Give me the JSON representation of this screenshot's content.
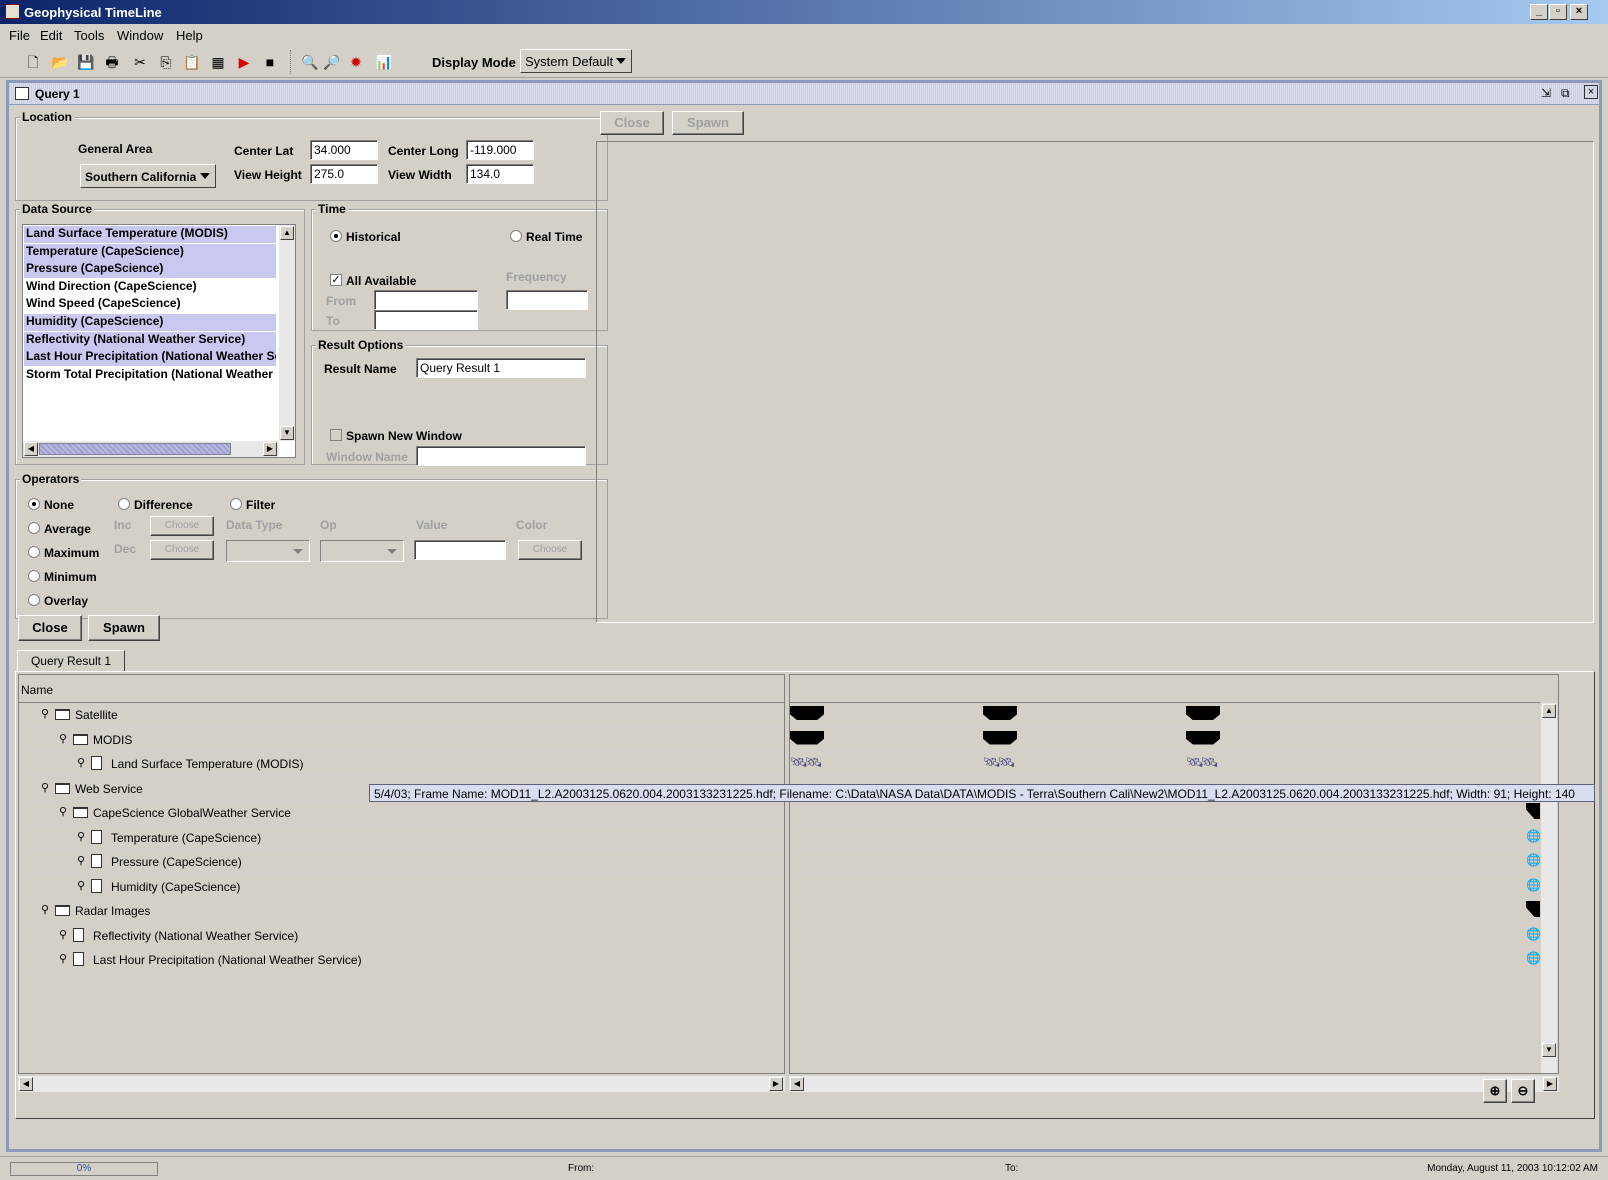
{
  "window": {
    "title": "Geophysical TimeLine"
  },
  "menu": [
    "File",
    "Edit",
    "Tools",
    "Window",
    "Help"
  ],
  "toolbar": {
    "display_mode_label": "Display Mode",
    "display_mode_value": "System Default"
  },
  "frame": {
    "title": "Query 1"
  },
  "location": {
    "title": "Location",
    "general_area_label": "General Area",
    "general_area_value": "Southern California",
    "center_lat_label": "Center Lat",
    "center_lat_value": "34.000",
    "center_long_label": "Center Long",
    "center_long_value": "-119.000",
    "view_height_label": "View Height",
    "view_height_value": "275.0",
    "view_width_label": "View Width",
    "view_width_value": "134.0"
  },
  "data_source": {
    "title": "Data Source",
    "items": [
      {
        "label": "Land Surface Temperature (MODIS)",
        "selected": true
      },
      {
        "label": "Temperature (CapeScience)",
        "selected": true
      },
      {
        "label": "Pressure (CapeScience)",
        "selected": true
      },
      {
        "label": "Wind Direction (CapeScience)",
        "selected": false
      },
      {
        "label": "Wind Speed (CapeScience)",
        "selected": false
      },
      {
        "label": "Humidity (CapeScience)",
        "selected": true
      },
      {
        "label": "Reflectivity (National Weather Service)",
        "selected": true
      },
      {
        "label": "Last Hour Precipitation (National Weather Ser",
        "selected": true
      },
      {
        "label": "Storm Total Precipitation (National Weather S",
        "selected": false
      }
    ]
  },
  "time": {
    "title": "Time",
    "historical_label": "Historical",
    "realtime_label": "Real Time",
    "all_available_label": "All Available",
    "frequency_label": "Frequency",
    "from_label": "From",
    "to_label": "To"
  },
  "result_options": {
    "title": "Result Options",
    "result_name_label": "Result Name",
    "result_name_value": "Query Result 1",
    "spawn_label": "Spawn New Window",
    "window_name_label": "Window Name"
  },
  "operators": {
    "title": "Operators",
    "none": "None",
    "difference": "Difference",
    "filter": "Filter",
    "average": "Average",
    "maximum": "Maximum",
    "minimum": "Minimum",
    "overlay": "Overlay",
    "inc": "Inc",
    "dec": "Dec",
    "choose": "Choose",
    "data_type": "Data Type",
    "op": "Op",
    "value": "Value",
    "color": "Color"
  },
  "buttons": {
    "close": "Close",
    "spawn": "Spawn"
  },
  "results": {
    "tab": "Query Result 1",
    "name_header": "Name",
    "rows": [
      {
        "label": "Satellite",
        "indent": 0,
        "type": "folder",
        "marks": "blocks"
      },
      {
        "label": "MODIS",
        "indent": 1,
        "type": "folder",
        "marks": "blocks"
      },
      {
        "label": "Land Surface Temperature (MODIS)",
        "indent": 2,
        "type": "doc",
        "marks": "sat"
      },
      {
        "label": "Web Service",
        "indent": 0,
        "type": "folder",
        "marks": "none"
      },
      {
        "label": "CapeScience GlobalWeather Service",
        "indent": 1,
        "type": "folder",
        "marks": "end"
      },
      {
        "label": "Temperature (CapeScience)",
        "indent": 2,
        "type": "doc",
        "marks": "globe"
      },
      {
        "label": "Pressure (CapeScience)",
        "indent": 2,
        "type": "doc",
        "marks": "globe"
      },
      {
        "label": "Humidity (CapeScience)",
        "indent": 2,
        "type": "doc",
        "marks": "globe"
      },
      {
        "label": "Radar Images",
        "indent": 0,
        "type": "folder",
        "marks": "end"
      },
      {
        "label": "Reflectivity (National Weather Service)",
        "indent": 1,
        "type": "doc",
        "marks": "globe"
      },
      {
        "label": "Last Hour Precipitation (National Weather Service)",
        "indent": 1,
        "type": "doc",
        "marks": "globe"
      }
    ],
    "tooltip": "5/4/03; Frame Name: MOD11_L2.A2003125.0620.004.2003133231225.hdf; Filename: C:\\Data\\NASA Data\\DATA\\MODIS - Terra\\Southern Cali\\New2\\MOD11_L2.A2003125.0620.004.2003133231225.hdf; Width: 91; Height: 140"
  },
  "status": {
    "progress": "0%",
    "from_label": "From:",
    "to_label": "To:",
    "datetime": "Monday, August 11, 2003 10:12:02 AM"
  },
  "icons": [
    "new-icon",
    "open-icon",
    "save-icon",
    "print-icon",
    "cut-icon",
    "copy-icon",
    "paste-icon",
    "table-icon",
    "play-icon",
    "stop-icon",
    "zoom-in-icon",
    "zoom-out-icon",
    "settings-icon",
    "chart-icon"
  ]
}
